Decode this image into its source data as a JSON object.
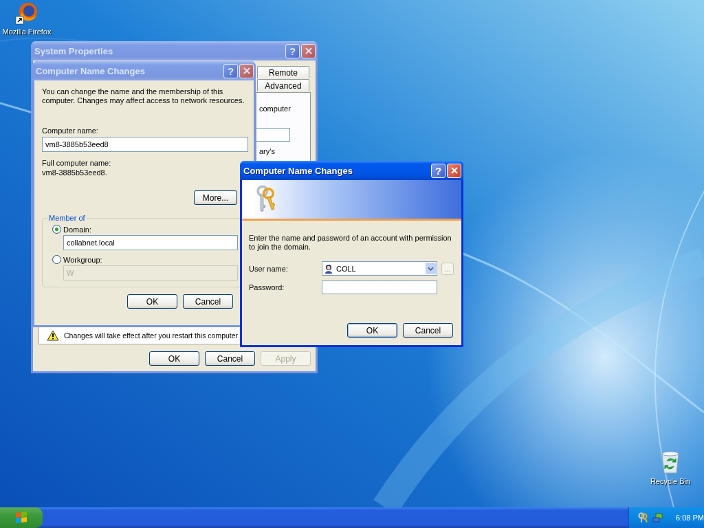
{
  "desktop_icons": [
    {
      "kind": "firefox",
      "label": "Mozilla Firefox"
    },
    {
      "kind": "recycle",
      "label": "Recycle Bin"
    }
  ],
  "system_properties": {
    "title": "System Properties",
    "active": false,
    "help_button": "?",
    "tabs": [
      {
        "label": "Remote",
        "selected": false
      },
      {
        "label": "Advanced",
        "selected": false
      }
    ],
    "panel_texts": [
      "computer",
      "ary's"
    ],
    "notice": "Changes will take effect after you restart this computer",
    "buttons": [
      {
        "label": "OK",
        "disabled": false
      },
      {
        "label": "Cancel",
        "disabled": false
      },
      {
        "label": "Apply",
        "disabled": true
      }
    ]
  },
  "name_changes": {
    "title": "Computer Name Changes",
    "active": false,
    "help_button": "?",
    "intro": "You can change the name and the membership of this computer. Changes may affect access to network resources.",
    "computer_name_label": "Computer name:",
    "computer_name": "vm8-3885b53eed8",
    "full_name_label": "Full computer name:",
    "full_name": "vm8-3885b53eed8.",
    "more_button": "More...",
    "group_title": "Member of",
    "options": [
      {
        "label": "Domain:",
        "selected": true,
        "value": "collabnet.local",
        "disabled": false
      },
      {
        "label": "Workgroup:",
        "selected": false,
        "value": "W",
        "disabled": true
      }
    ],
    "buttons": [
      {
        "label": "OK",
        "disabled": false
      },
      {
        "label": "Cancel",
        "disabled": false
      }
    ]
  },
  "credentials": {
    "title": "Computer Name Changes",
    "active": true,
    "help_button": "?",
    "intro": "Enter the name and password of an account with permission to join the domain.",
    "user_label": "User name:",
    "user_value": "COLL",
    "browse_button": "...",
    "browse_disabled": true,
    "password_label": "Password:",
    "buttons": [
      {
        "label": "OK",
        "disabled": false
      },
      {
        "label": "Cancel",
        "disabled": false
      }
    ]
  },
  "taskbar": {
    "clock": "6:08 PM"
  }
}
